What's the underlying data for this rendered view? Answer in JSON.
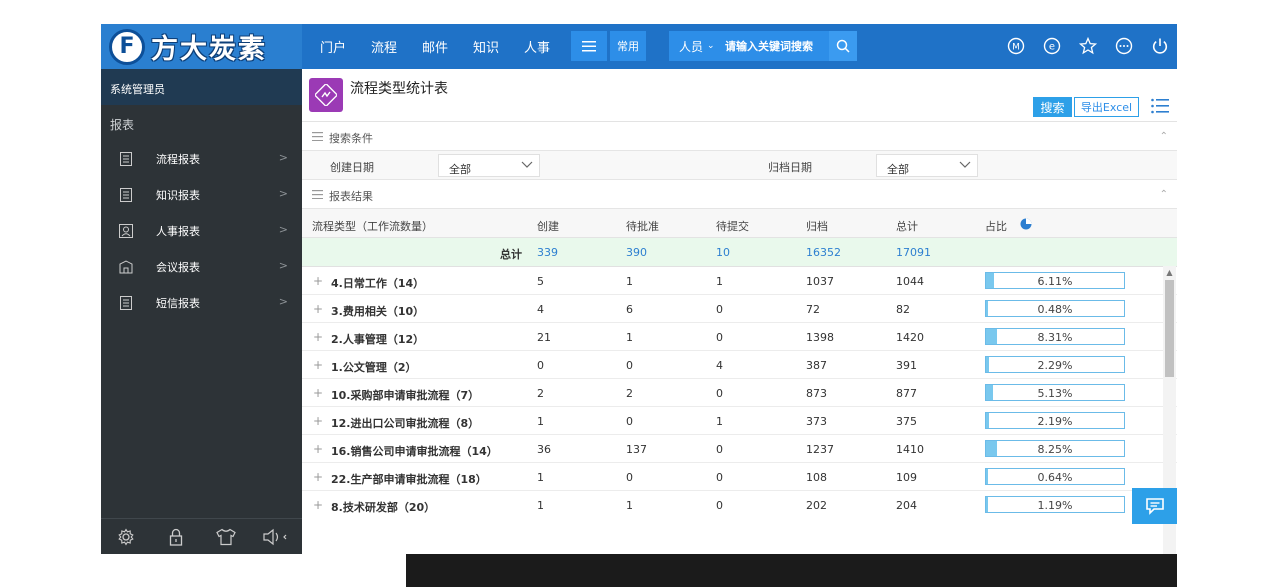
{
  "header": {
    "logo_mark": "F",
    "logo_text": "方大炭素",
    "nav": [
      "门户",
      "流程",
      "邮件",
      "知识",
      "人事"
    ],
    "common_label": "常用",
    "search_scope": "人员",
    "search_placeholder": "请输入关键词搜索"
  },
  "sidebar": {
    "user": "系统管理员",
    "section_title": "报表",
    "items": [
      {
        "label": "流程报表",
        "icon": "doc-icon"
      },
      {
        "label": "知识报表",
        "icon": "doc-icon"
      },
      {
        "label": "人事报表",
        "icon": "person-card-icon"
      },
      {
        "label": "会议报表",
        "icon": "meeting-icon"
      },
      {
        "label": "短信报表",
        "icon": "doc-icon"
      }
    ]
  },
  "page": {
    "title": "流程类型统计表",
    "btn_search": "搜索",
    "btn_export": "导出Excel"
  },
  "search_section": {
    "title": "搜索条件",
    "create_label": "创建日期",
    "create_value": "全部",
    "archive_label": "归档日期",
    "archive_value": "全部"
  },
  "result_section": {
    "title": "报表结果"
  },
  "table": {
    "headers": {
      "type": "流程类型（工作流数量）",
      "created": "创建",
      "pending": "待批准",
      "submit": "待提交",
      "archived": "归档",
      "total": "总计",
      "ratio": "占比"
    },
    "total_row": {
      "label": "总计",
      "created": "339",
      "pending": "390",
      "submit": "10",
      "archived": "16352",
      "total": "17091"
    },
    "rows": [
      {
        "name": "4.日常工作（14）",
        "created": "5",
        "pending": "1",
        "submit": "1",
        "archived": "1037",
        "total": "1044",
        "pct": "6.11%",
        "ratio": 0.0611
      },
      {
        "name": "3.费用相关（10）",
        "created": "4",
        "pending": "6",
        "submit": "0",
        "archived": "72",
        "total": "82",
        "pct": "0.48%",
        "ratio": 0.0048
      },
      {
        "name": "2.人事管理（12）",
        "created": "21",
        "pending": "1",
        "submit": "0",
        "archived": "1398",
        "total": "1420",
        "pct": "8.31%",
        "ratio": 0.0831
      },
      {
        "name": "1.公文管理（2）",
        "created": "0",
        "pending": "0",
        "submit": "4",
        "archived": "387",
        "total": "391",
        "pct": "2.29%",
        "ratio": 0.0229
      },
      {
        "name": "10.采购部申请审批流程（7）",
        "created": "2",
        "pending": "2",
        "submit": "0",
        "archived": "873",
        "total": "877",
        "pct": "5.13%",
        "ratio": 0.0513
      },
      {
        "name": "12.进出口公司审批流程（8）",
        "created": "1",
        "pending": "0",
        "submit": "1",
        "archived": "373",
        "total": "375",
        "pct": "2.19%",
        "ratio": 0.0219
      },
      {
        "name": "16.销售公司申请审批流程（14）",
        "created": "36",
        "pending": "137",
        "submit": "0",
        "archived": "1237",
        "total": "1410",
        "pct": "8.25%",
        "ratio": 0.0825
      },
      {
        "name": "22.生产部申请审批流程（18）",
        "created": "1",
        "pending": "0",
        "submit": "0",
        "archived": "108",
        "total": "109",
        "pct": "0.64%",
        "ratio": 0.0064
      },
      {
        "name": "8.技术研发部（20）",
        "created": "1",
        "pending": "1",
        "submit": "0",
        "archived": "202",
        "total": "204",
        "pct": "1.19%",
        "ratio": 0.0119
      }
    ]
  },
  "colors": {
    "header_blue": "#1f72c7",
    "accent": "#2da0e8",
    "sidebar": "#2d3337",
    "bar_fill": "#79c8ee",
    "total_row_bg": "#e9f9ec",
    "page_icon": "#9b3ab5"
  }
}
